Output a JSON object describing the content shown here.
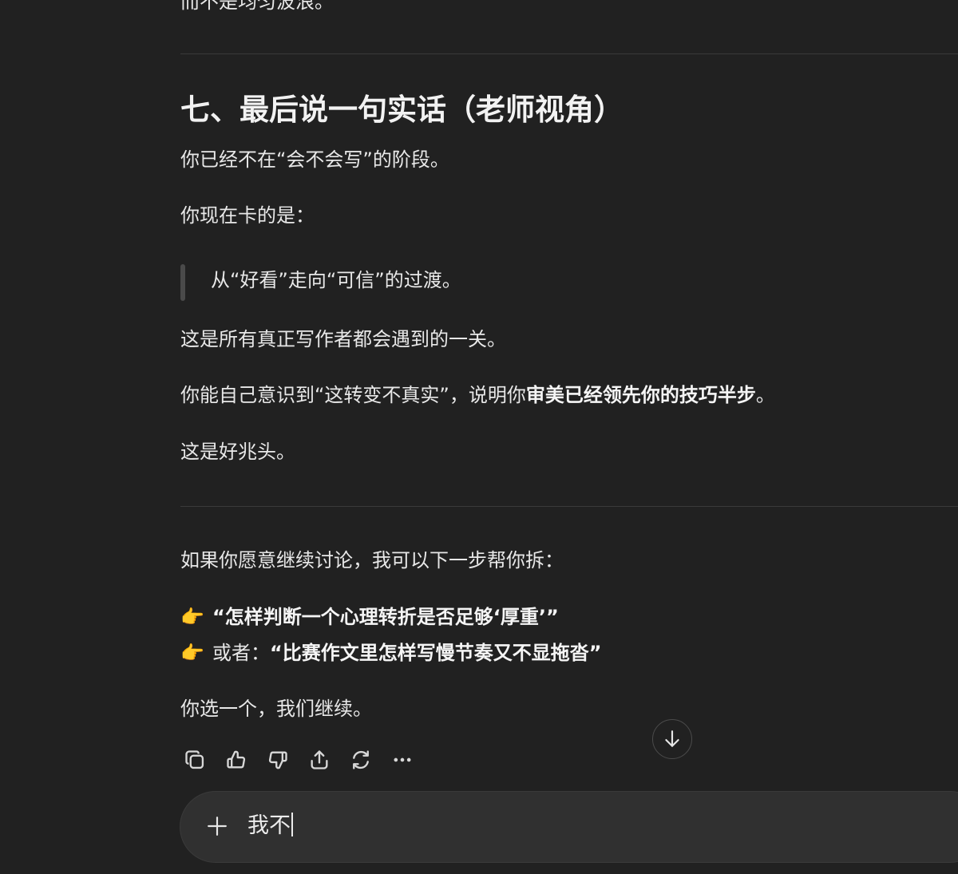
{
  "article": {
    "cut_line": "而不是均匀波浪。",
    "section_heading": "七、最后说一句实话（老师视角）",
    "p1": "你已经不在“会不会写”的阶段。",
    "p2": "你现在卡的是：",
    "quote": "从“好看”走向“可信”的过渡。",
    "p3": "这是所有真正写作者都会遇到的一关。",
    "p4_prefix": "你能自己意识到“这转变不真实”，说明你",
    "p4_bold": "审美已经领先你的技巧半步",
    "p4_suffix": "。",
    "p5": "这是好兆头。",
    "p6": "如果你愿意继续讨论，我可以下一步帮你拆：",
    "option1_emoji": "👉",
    "option1": "“怎样判断一个心理转折是否足够‘厚重’”",
    "option2_emoji": "👉",
    "option2_prefix": "或者：",
    "option2": "“比赛作文里怎样写慢节奏又不显拖沓”",
    "p7": "你选一个，我们继续。"
  },
  "actions": {
    "copy_icon": "copy-icon",
    "like_icon": "thumbs-up-icon",
    "dislike_icon": "thumbs-down-icon",
    "share_icon": "share-icon",
    "regenerate_icon": "regenerate-icon",
    "more_icon": "more-icon"
  },
  "scroll_down_icon": "arrow-down-icon",
  "composer": {
    "add_icon": "plus-icon",
    "input_value": "我不"
  },
  "colors": {
    "background": "#212121",
    "composer_background": "#303030",
    "text": "#ececec",
    "emoji_hand": "#f5b400"
  }
}
